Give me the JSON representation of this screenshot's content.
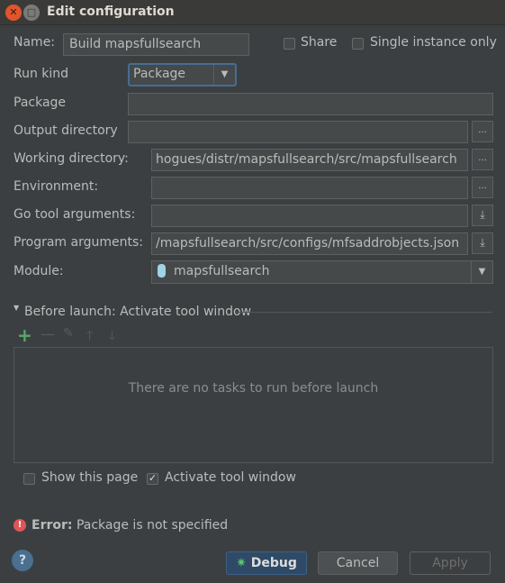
{
  "window": {
    "title": "Edit configuration"
  },
  "form": {
    "name_label": "Name:",
    "name_value": "Build mapsfullsearch",
    "share_label": "Share",
    "single_instance_label": "Single instance only",
    "run_kind_label": "Run kind",
    "run_kind_value": "Package",
    "package_label": "Package",
    "package_value": "",
    "output_dir_label": "Output directory",
    "output_dir_value": "",
    "working_dir_label": "Working directory:",
    "working_dir_value": "hogues/distr/mapsfullsearch/src/mapsfullsearch",
    "environment_label": "Environment:",
    "environment_value": "",
    "go_tool_args_label": "Go tool arguments:",
    "go_tool_args_value": "",
    "program_args_label": "Program arguments:",
    "program_args_value": "/mapsfullsearch/src/configs/mfsaddrobjects.json",
    "module_label": "Module:",
    "module_value": "mapsfullsearch",
    "browse_label": "..."
  },
  "before_launch": {
    "title": "Before launch: Activate tool window",
    "empty_text": "There are no tasks to run before launch",
    "show_page_label": "Show this page",
    "show_page_checked": false,
    "activate_label": "Activate tool window",
    "activate_checked": true
  },
  "error": {
    "label": "Error:",
    "message": "Package is not specified"
  },
  "buttons": {
    "help": "?",
    "debug": "Debug",
    "cancel": "Cancel",
    "apply": "Apply"
  },
  "colors": {
    "accent": "#3d6185",
    "error": "#e05555",
    "add": "#59a869"
  }
}
